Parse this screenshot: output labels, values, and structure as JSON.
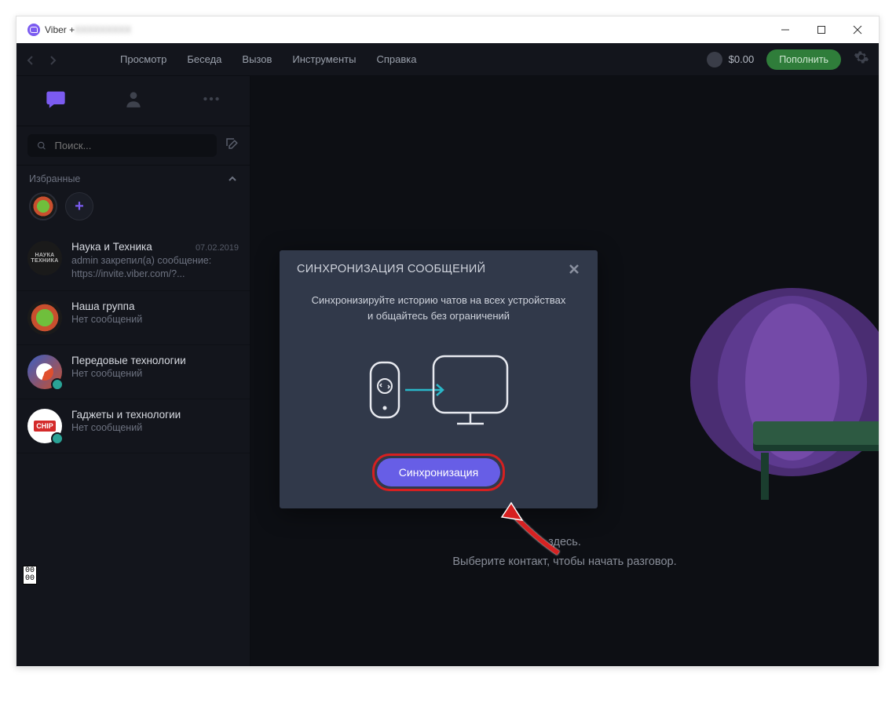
{
  "window": {
    "title_prefix": "Viber +",
    "title_blur": "XXXXXXXXX"
  },
  "menu": {
    "view": "Просмотр",
    "chat": "Беседа",
    "call": "Вызов",
    "tools": "Инструменты",
    "help": "Справка"
  },
  "balance": {
    "amount": "$0.00"
  },
  "topup_label": "Пополнить",
  "sidebar": {
    "search_placeholder": "Поиск...",
    "favorites_label": "Избранные",
    "chats": [
      {
        "name": "Наука и Техника",
        "date": "07.02.2019",
        "msg": "admin закрепил(а) сообщение: https://invite.viber.com/?...",
        "ava_label1": "НАУКА",
        "ava_label2": "ТЕХНИКА"
      },
      {
        "name": "Наша группа",
        "msg": "Нет сообщений"
      },
      {
        "name": "Передовые технологии",
        "msg": "Нет сообщений"
      },
      {
        "name": "Гаджеты и технологии",
        "msg": "Нет сообщений",
        "ava_label": "CHIP"
      }
    ]
  },
  "empty": {
    "line1": "здесь.",
    "line2": "Выберите контакт, чтобы начать разговор."
  },
  "modal": {
    "title": "СИНХРОНИЗАЦИЯ СООБЩЕНИЙ",
    "text": "Синхронизируйте историю чатов на всех устройствах и общайтесь без ограничений",
    "button": "Синхронизация"
  },
  "floater": "00\n00"
}
